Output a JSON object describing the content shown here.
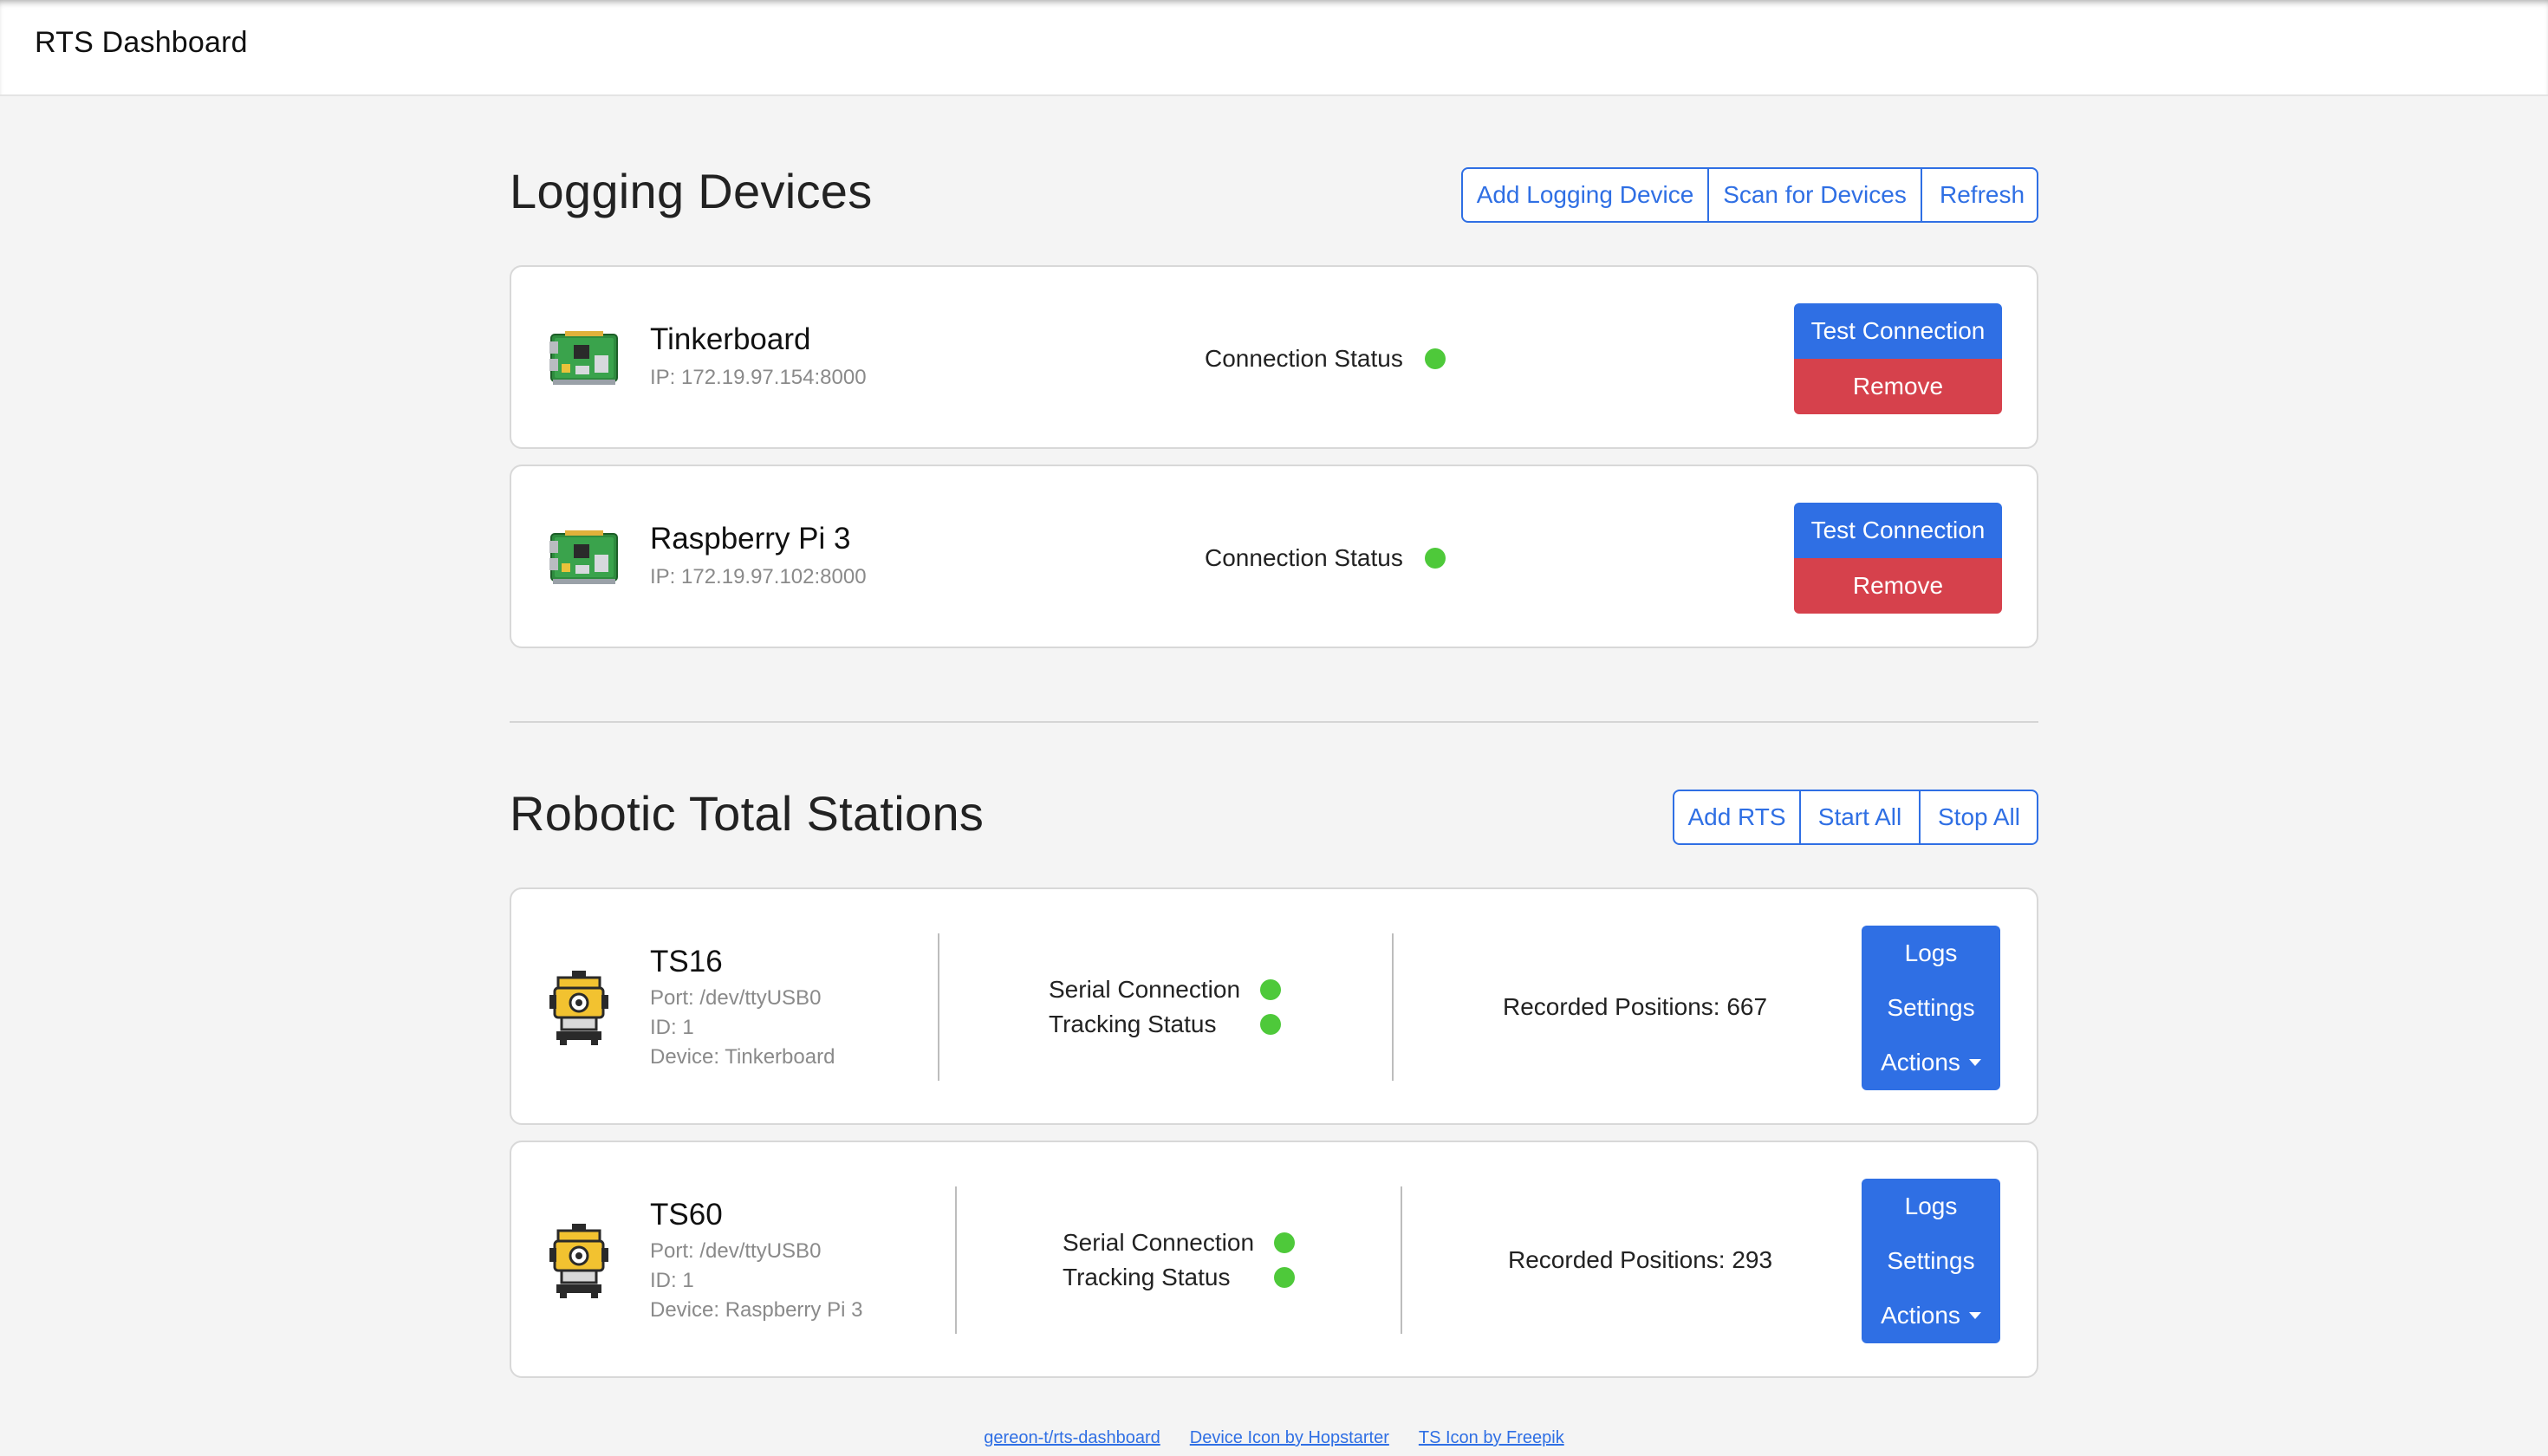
{
  "app": {
    "title": "RTS Dashboard"
  },
  "logging": {
    "title": "Logging Devices",
    "buttons": {
      "add": "Add Logging Device",
      "scan": "Scan for Devices",
      "refresh": "Refresh"
    },
    "devices": [
      {
        "name": "Tinkerboard",
        "ip": "IP: 172.19.97.154:8000",
        "status_label": "Connection Status",
        "status_color": "#4ec93a",
        "test_label": "Test Connection",
        "remove_label": "Remove",
        "icon": "circuit-board-icon"
      },
      {
        "name": "Raspberry Pi 3",
        "ip": "IP: 172.19.97.102:8000",
        "status_label": "Connection Status",
        "status_color": "#4ec93a",
        "test_label": "Test Connection",
        "remove_label": "Remove",
        "icon": "circuit-board-icon"
      }
    ]
  },
  "rts": {
    "title": "Robotic Total Stations",
    "buttons": {
      "add": "Add RTS",
      "start": "Start All",
      "stop": "Stop All"
    },
    "stations": [
      {
        "name": "TS16",
        "port": "Port: /dev/ttyUSB0",
        "id": "ID: 1",
        "device": "Device: Tinkerboard",
        "serial_label": "Serial Connection",
        "tracking_label": "Tracking Status",
        "recorded": "Recorded Positions: 667",
        "logs": "Logs",
        "settings": "Settings",
        "actions": "Actions",
        "icon": "total-station-icon"
      },
      {
        "name": "TS60",
        "port": "Port: /dev/ttyUSB0",
        "id": "ID: 1",
        "device": "Device: Raspberry Pi 3",
        "serial_label": "Serial Connection",
        "tracking_label": "Tracking Status",
        "recorded": "Recorded Positions: 293",
        "logs": "Logs",
        "settings": "Settings",
        "actions": "Actions",
        "icon": "total-station-icon"
      }
    ]
  },
  "footer": {
    "links": [
      "gereon-t/rts-dashboard",
      "Device Icon by Hopstarter",
      "TS Icon by Freepik"
    ]
  },
  "colors": {
    "primary": "#2f6fe4",
    "danger": "#d6414c",
    "ok": "#4ec93a"
  }
}
